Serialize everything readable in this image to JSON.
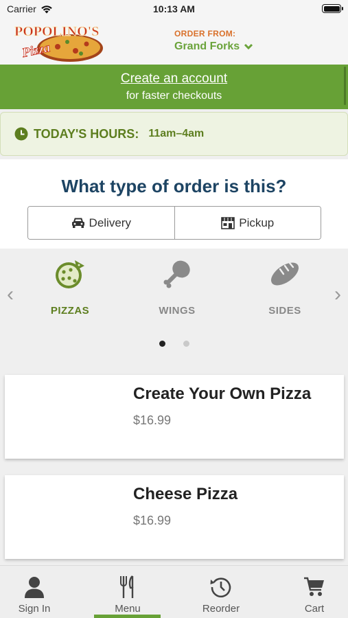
{
  "status_bar": {
    "carrier": "Carrier",
    "time": "10:13 AM"
  },
  "header": {
    "logo_text": "POPOLINO'S",
    "logo_sub": "Pizza",
    "order_from_label": "ORDER FROM:",
    "location": "Grand Forks"
  },
  "account_banner": {
    "link": "Create an account",
    "subtitle": "for faster checkouts"
  },
  "hours": {
    "title": "TODAY'S HOURS:",
    "value": "11am–4am"
  },
  "order_type": {
    "question": "What type of order is this?",
    "options": [
      {
        "label": "Delivery",
        "icon": "car-icon"
      },
      {
        "label": "Pickup",
        "icon": "store-icon"
      }
    ]
  },
  "categories": {
    "items": [
      {
        "label": "PIZZAS",
        "icon": "pizza-icon",
        "active": true
      },
      {
        "label": "WINGS",
        "icon": "drumstick-icon",
        "active": false
      },
      {
        "label": "SIDES",
        "icon": "bread-icon",
        "active": false
      }
    ],
    "pages": 2,
    "current_page": 1
  },
  "menu_items": [
    {
      "name": "Create Your Own Pizza",
      "price": "$16.99"
    },
    {
      "name": "Cheese Pizza",
      "price": "$16.99"
    }
  ],
  "tab_bar": {
    "tabs": [
      {
        "label": "Sign In",
        "icon": "person-icon"
      },
      {
        "label": "Menu",
        "icon": "fork-knife-icon",
        "active": true
      },
      {
        "label": "Reorder",
        "icon": "reorder-icon"
      },
      {
        "label": "Cart",
        "icon": "cart-icon"
      }
    ]
  },
  "colors": {
    "brand_green": "#67a136",
    "accent_orange": "#d9702a",
    "heading_navy": "#1d4463",
    "hours_text": "#5d7e1f"
  }
}
